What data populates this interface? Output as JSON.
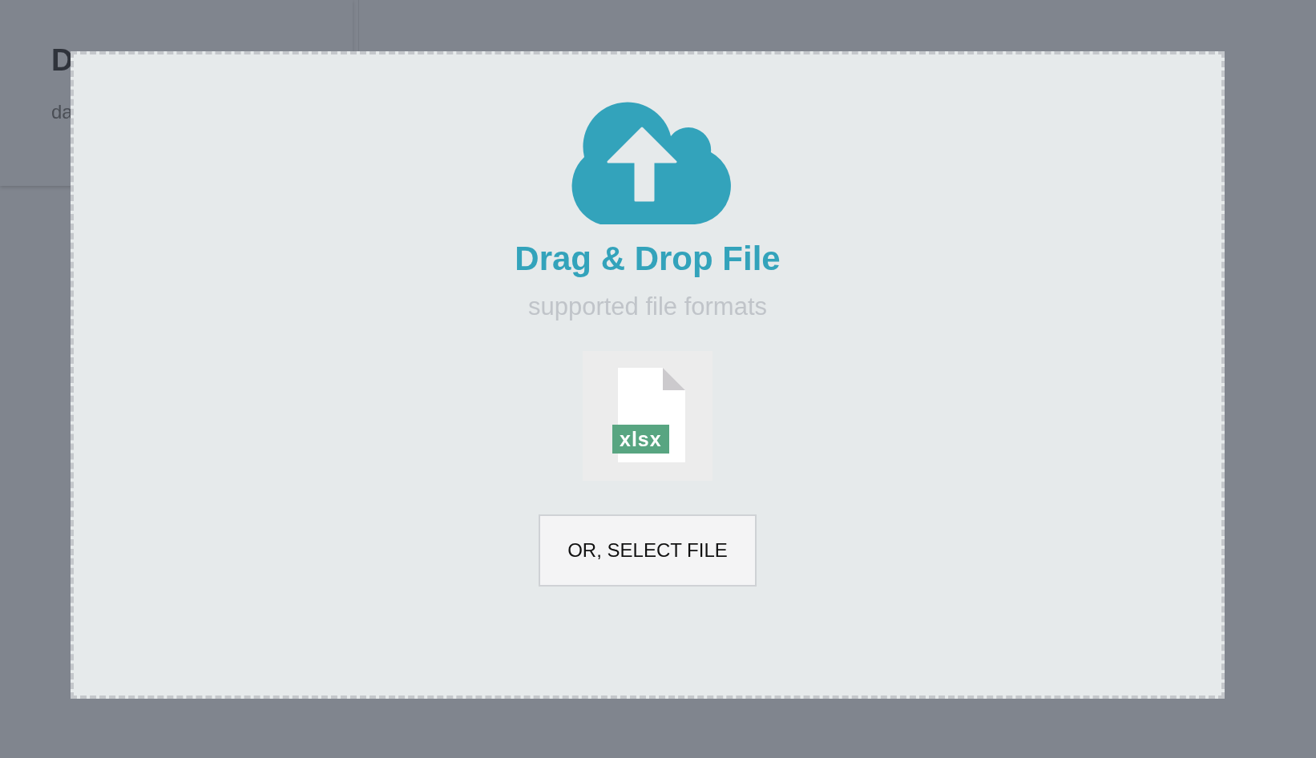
{
  "background_card": {
    "title": "D",
    "text": "da"
  },
  "dropzone": {
    "title": "Drag & Drop File",
    "subtitle": "supported file formats",
    "formats": [
      {
        "label": "xlsx"
      }
    ],
    "button": "OR, SELECT FILE"
  }
}
